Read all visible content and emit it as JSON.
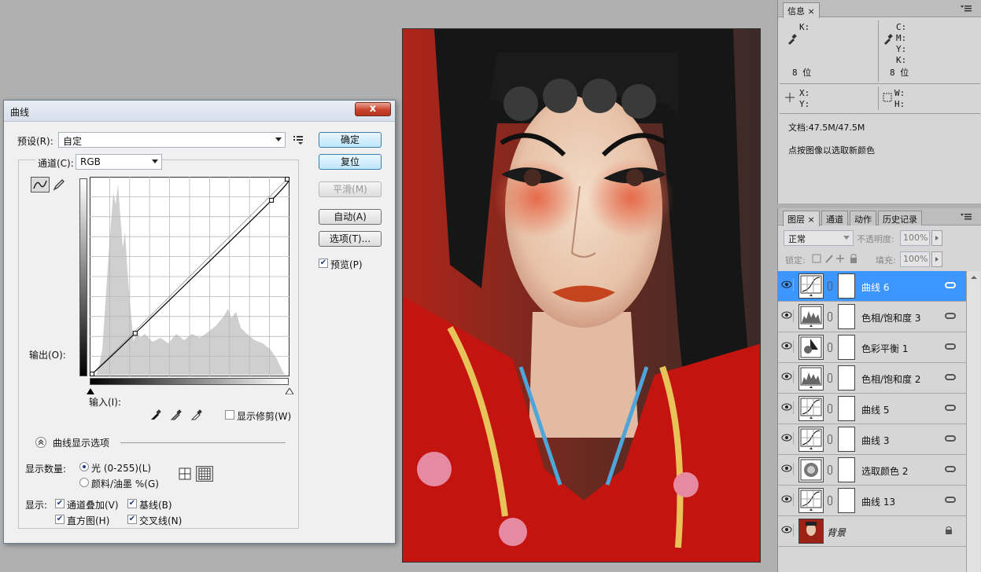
{
  "dialog": {
    "title": "曲线",
    "close_label": "x",
    "preset_label": "预设(R):",
    "preset_value": "自定",
    "channel_label": "通道(C):",
    "channel_value": "RGB",
    "output_label": "输出(O):",
    "input_label": "输入(I):",
    "show_clipping_label": "显示修剪(W)",
    "buttons": {
      "ok": "确定",
      "reset": "复位",
      "smooth": "平滑(M)",
      "auto": "自动(A)",
      "options": "选项(T)..."
    },
    "preview_label": "预览(P)",
    "preview_checked": true,
    "display_options_title": "曲线显示选项",
    "show_amount_label": "显示数量:",
    "radio_light": "光 (0-255)(L)",
    "radio_pigment": "颜料/油墨 %(G)",
    "show_label": "显示:",
    "check_channel_overlay": "通道叠加(V)",
    "check_baseline": "基线(B)",
    "check_histogram": "直方图(H)",
    "check_intersection": "交叉线(N)",
    "curve_points": [
      [
        0,
        0
      ],
      [
        58,
        55
      ],
      [
        232,
        225
      ],
      [
        255,
        255
      ]
    ]
  },
  "info_panel": {
    "tab": "信息",
    "k_label": "K:",
    "c_label": "C:",
    "m_label": "M:",
    "y_label": "Y:",
    "k2_label": "K:",
    "bits_left": "8 位",
    "bits_right": "8 位",
    "x_label": "X:",
    "y2_label": "Y:",
    "w_label": "W:",
    "h_label": "H:",
    "doc_size": "文档:47.5M/47.5M",
    "hint": "点按图像以选取新颜色"
  },
  "layers_panel": {
    "tabs": [
      "图层",
      "通道",
      "动作",
      "历史记录"
    ],
    "blend_mode": "正常",
    "opacity_label": "不透明度:",
    "opacity_value": "100%",
    "lock_label": "锁定:",
    "fill_label": "填充:",
    "fill_value": "100%",
    "layers": [
      {
        "name": "曲线 6",
        "thumb": "curves-icon",
        "selected": true
      },
      {
        "name": "色相/饱和度 3",
        "thumb": "hue-saturation-icon",
        "selected": false
      },
      {
        "name": "色彩平衡 1",
        "thumb": "color-balance-icon",
        "selected": false
      },
      {
        "name": "色相/饱和度 2",
        "thumb": "hue-saturation-icon",
        "selected": false
      },
      {
        "name": "曲线 5",
        "thumb": "curves-icon",
        "selected": false
      },
      {
        "name": "曲线 3",
        "thumb": "curves-icon",
        "selected": false
      },
      {
        "name": "选取颜色 2",
        "thumb": "selective-color-icon",
        "selected": false
      },
      {
        "name": "曲线 13",
        "thumb": "curves-icon",
        "selected": false
      },
      {
        "name": "背景",
        "thumb": "photo-thumbnail",
        "selected": false
      }
    ]
  }
}
